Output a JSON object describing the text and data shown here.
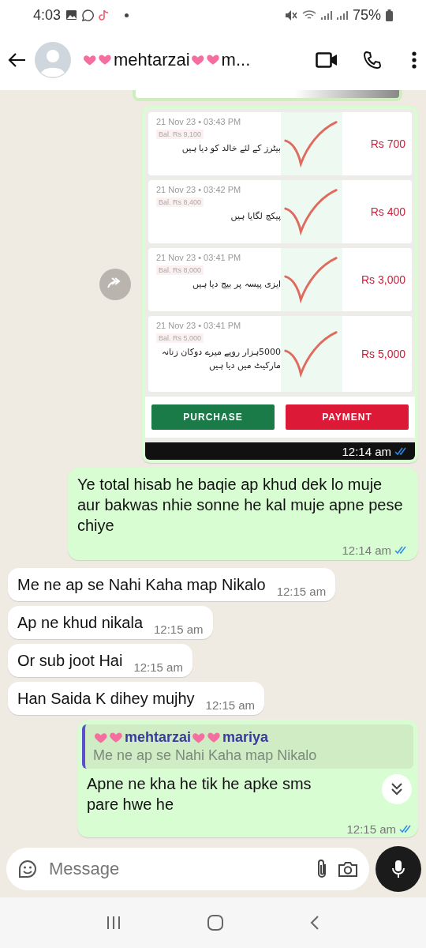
{
  "status_bar": {
    "time": "4:03",
    "battery": "75%"
  },
  "header": {
    "name_start": "mehtarzai",
    "name_end": "m..."
  },
  "messages": [
    {
      "kind": "image",
      "time": "12:14 am",
      "read": true,
      "entries": [
        {
          "date": "21 Nov 23 • 03:43 PM",
          "balance": "Bal. Rs 9,100",
          "note": "بیٹرز کے لئے خالد کو دیا ہیں",
          "amount": "Rs 700"
        },
        {
          "date": "21 Nov 23 • 03:42 PM",
          "balance": "Bal. Rs 8,400",
          "note": "پیکج لگایا ہیں",
          "amount": "Rs 400"
        },
        {
          "date": "21 Nov 23 • 03:41 PM",
          "balance": "Bal. Rs 8,000",
          "note": "ایزی پیسہ پر بیج دیا ہیں",
          "amount": "Rs 3,000"
        },
        {
          "date": "21 Nov 23 • 03:41 PM",
          "balance": "Bal. Rs 5,000",
          "note": "5000ہزار روپے میرے دوکان زنانہ مارکیٹ میں دیا ہیں",
          "amount": "Rs 5,000"
        }
      ],
      "buttons": [
        {
          "label": "PURCHASE",
          "color": "#1a7a48"
        },
        {
          "label": "PAYMENT",
          "color": "#dc1a37"
        }
      ]
    },
    {
      "kind": "outgoing",
      "text": "Ye total hisab he baqie ap khud dek lo muje aur bakwas nhie sonne he kal muje apne pese chiye",
      "time": "12:14 am",
      "read": true
    },
    {
      "kind": "incoming",
      "text": "Me ne ap se Nahi Kaha map Nikalo",
      "time": "12:15 am"
    },
    {
      "kind": "incoming",
      "text": "Ap ne khud nikala",
      "time": "12:15 am"
    },
    {
      "kind": "incoming",
      "text": "Or sub joot Hai",
      "time": "12:15 am"
    },
    {
      "kind": "incoming",
      "text": "Han Saida K dihey mujhy",
      "time": "12:15 am"
    },
    {
      "kind": "reply",
      "quote_name_start": "mehtarzai",
      "quote_name_end": "mariya",
      "quote_text": "Me ne ap se Nahi Kaha map Nikalo",
      "text": "Apne ne kha he tik he apke sms pare hwe he",
      "time": "12:15 am",
      "read": true
    }
  ],
  "composer": {
    "placeholder": "Message"
  }
}
